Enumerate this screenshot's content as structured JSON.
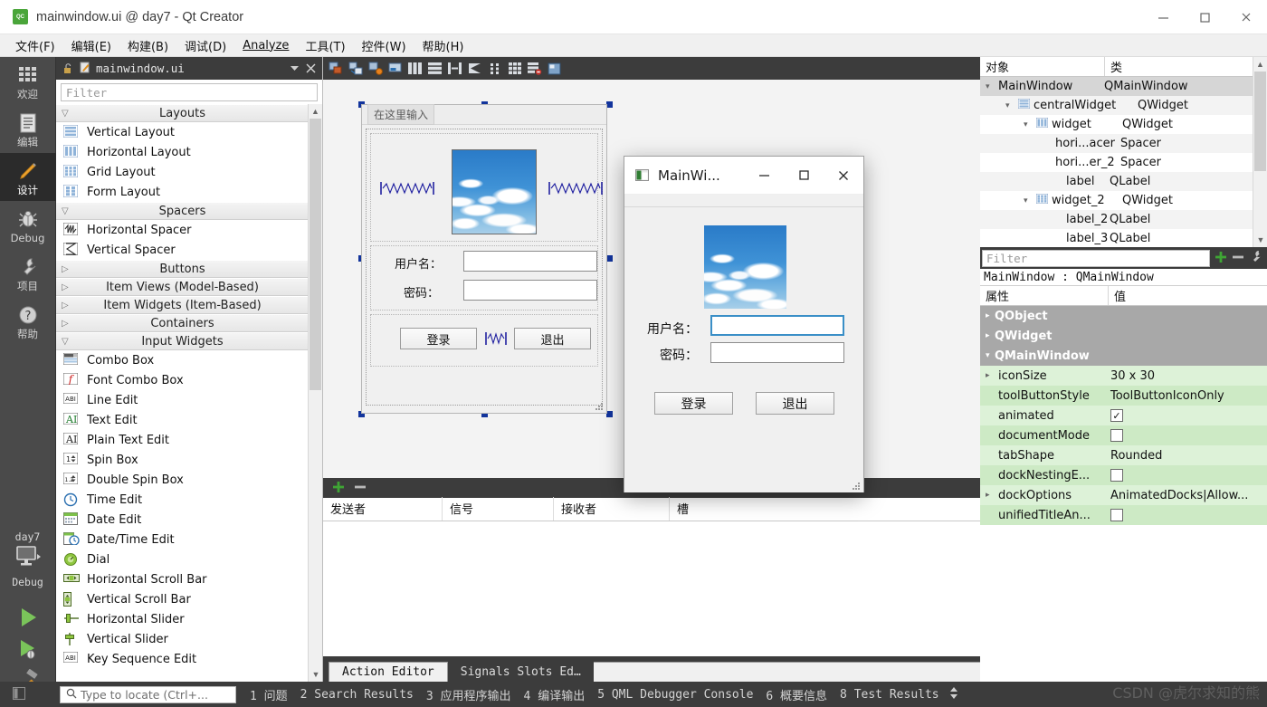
{
  "window": {
    "title": "mainwindow.ui @ day7 - Qt Creator",
    "app_icon": "qt-creator-icon",
    "minimize": "–",
    "maximize": "□",
    "close": "✕"
  },
  "menubar": {
    "items": [
      {
        "label": "文件(F)",
        "mnemonic": "F"
      },
      {
        "label": "编辑(E)",
        "mnemonic": "E"
      },
      {
        "label": "构建(B)",
        "mnemonic": "B"
      },
      {
        "label": "调试(D)",
        "mnemonic": "D"
      },
      {
        "label": "Analyze",
        "mnemonic": "A"
      },
      {
        "label": "工具(T)",
        "mnemonic": "T"
      },
      {
        "label": "控件(W)",
        "mnemonic": "W"
      },
      {
        "label": "帮助(H)",
        "mnemonic": "H"
      }
    ]
  },
  "modebar": {
    "modes": [
      {
        "label": "欢迎",
        "icon": "grid-icon",
        "active": false
      },
      {
        "label": "编辑",
        "icon": "document-icon",
        "active": false
      },
      {
        "label": "设计",
        "icon": "pencil-icon",
        "active": true
      },
      {
        "label": "Debug",
        "icon": "bug-icon",
        "active": false
      },
      {
        "label": "项目",
        "icon": "wrench-icon",
        "active": false
      },
      {
        "label": "帮助",
        "icon": "question-icon",
        "active": false
      }
    ],
    "kit": {
      "project": "day7",
      "config": "Debug",
      "icon": "desktop-icon"
    },
    "run_button": "run-icon",
    "debug_button": "run-debug-icon",
    "build_button": "hammer-icon"
  },
  "widgetbox": {
    "tab_label": "mainwindow.ui",
    "tab_icon": "file-edit-icon",
    "lock_icon": "unlocked-icon",
    "dropdown_icon": "chevron-down-icon",
    "close_icon": "close-icon",
    "filter_placeholder": "Filter",
    "groups": [
      {
        "name": "Layouts",
        "expanded": true,
        "items": [
          {
            "label": "Vertical Layout",
            "icon": "vertical-layout-icon"
          },
          {
            "label": "Horizontal Layout",
            "icon": "horizontal-layout-icon"
          },
          {
            "label": "Grid Layout",
            "icon": "grid-layout-icon"
          },
          {
            "label": "Form Layout",
            "icon": "form-layout-icon"
          }
        ]
      },
      {
        "name": "Spacers",
        "expanded": true,
        "items": [
          {
            "label": "Horizontal Spacer",
            "icon": "horizontal-spacer-icon"
          },
          {
            "label": "Vertical Spacer",
            "icon": "vertical-spacer-icon"
          }
        ]
      },
      {
        "name": "Buttons",
        "expanded": false,
        "items": []
      },
      {
        "name": "Item Views (Model-Based)",
        "expanded": false,
        "items": []
      },
      {
        "name": "Item Widgets (Item-Based)",
        "expanded": false,
        "items": []
      },
      {
        "name": "Containers",
        "expanded": false,
        "items": []
      },
      {
        "name": "Input Widgets",
        "expanded": true,
        "items": [
          {
            "label": "Combo Box",
            "icon": "combobox-icon"
          },
          {
            "label": "Font Combo Box",
            "icon": "fontcombo-icon"
          },
          {
            "label": "Line Edit",
            "icon": "lineedit-icon"
          },
          {
            "label": "Text Edit",
            "icon": "textedit-icon"
          },
          {
            "label": "Plain Text Edit",
            "icon": "plaintextedit-icon"
          },
          {
            "label": "Spin Box",
            "icon": "spinbox-icon"
          },
          {
            "label": "Double Spin Box",
            "icon": "doublespinbox-icon"
          },
          {
            "label": "Time Edit",
            "icon": "timeedit-icon"
          },
          {
            "label": "Date Edit",
            "icon": "dateedit-icon"
          },
          {
            "label": "Date/Time Edit",
            "icon": "datetimeedit-icon"
          },
          {
            "label": "Dial",
            "icon": "dial-icon"
          },
          {
            "label": "Horizontal Scroll Bar",
            "icon": "hscrollbar-icon"
          },
          {
            "label": "Vertical Scroll Bar",
            "icon": "vscrollbar-icon"
          },
          {
            "label": "Horizontal Slider",
            "icon": "hslider-icon"
          },
          {
            "label": "Vertical Slider",
            "icon": "vslider-icon"
          },
          {
            "label": "Key Sequence Edit",
            "icon": "keysequence-icon"
          }
        ]
      }
    ]
  },
  "designer": {
    "toolbar_icons": [
      "edit-widgets-icon",
      "edit-signals-slots-icon",
      "edit-buddies-icon",
      "edit-tab-order-icon",
      "layout-horizontal-icon",
      "layout-vertical-icon",
      "layout-splitter-h-icon",
      "layout-splitter-v-icon",
      "layout-form-icon",
      "layout-grid-icon",
      "break-layout-icon",
      "adjust-size-icon"
    ],
    "form": {
      "menubar_hint": "在这里输入",
      "image_label": "sky-image",
      "fields": [
        {
          "label": "用户名：",
          "value": ""
        },
        {
          "label": "密码：",
          "value": ""
        }
      ],
      "buttons": [
        {
          "label": "登录"
        },
        {
          "label": "退出"
        }
      ],
      "spacers": [
        "horizontal-spacer",
        "horizontal-spacer-2",
        "button-spacer"
      ]
    }
  },
  "preview": {
    "title": "MainWi...",
    "icon": "app-window-icon",
    "minimize": "–",
    "maximize": "□",
    "close": "✕",
    "image_label": "sky-image",
    "fields": [
      {
        "label": "用户名：",
        "value": "",
        "focused": true
      },
      {
        "label": "密码：",
        "value": "",
        "focused": false
      }
    ],
    "buttons": [
      {
        "label": "登录"
      },
      {
        "label": "退出"
      }
    ]
  },
  "signal_slot_editor": {
    "add_icon": "plus-icon",
    "remove_icon": "minus-icon",
    "columns": [
      "发送者",
      "信号",
      "接收者",
      "槽"
    ],
    "rows": [],
    "tabs": [
      {
        "label": "Action Editor",
        "active": true
      },
      {
        "label": "Signals  Slots Ed…",
        "active": false
      }
    ]
  },
  "object_inspector": {
    "columns": [
      "对象",
      "类"
    ],
    "rows": [
      {
        "name": "MainWindow",
        "class": "QMainWindow",
        "indent": 0,
        "twisty": "v",
        "icon": "",
        "selected": true
      },
      {
        "name": "centralWidget",
        "class": "QWidget",
        "indent": 1,
        "twisty": "v",
        "icon": "vertical-layout-icon",
        "selected": false
      },
      {
        "name": "widget",
        "class": "QWidget",
        "indent": 2,
        "twisty": "v",
        "icon": "horizontal-layout-icon",
        "selected": false
      },
      {
        "name": "hori...acer",
        "class": "Spacer",
        "indent": 3,
        "twisty": "",
        "icon": "",
        "selected": false
      },
      {
        "name": "hori...er_2",
        "class": "Spacer",
        "indent": 3,
        "twisty": "",
        "icon": "",
        "selected": false
      },
      {
        "name": "label",
        "class": "QLabel",
        "indent": 3,
        "twisty": "",
        "icon": "",
        "selected": false
      },
      {
        "name": "widget_2",
        "class": "QWidget",
        "indent": 2,
        "twisty": "v",
        "icon": "grid-layout-icon",
        "selected": false
      },
      {
        "name": "label_2",
        "class": "QLabel",
        "indent": 3,
        "twisty": "",
        "icon": "",
        "selected": false
      },
      {
        "name": "label_3",
        "class": "QLabel",
        "indent": 3,
        "twisty": "",
        "icon": "",
        "selected": false
      }
    ]
  },
  "property_editor": {
    "filter_placeholder": "Filter",
    "add_icon": "plus-icon",
    "remove_icon": "minus-icon",
    "configure_icon": "wrench-icon",
    "object_line": "MainWindow : QMainWindow",
    "columns": [
      "属性",
      "值"
    ],
    "groups": [
      {
        "name": "QObject",
        "expanded": false
      },
      {
        "name": "QWidget",
        "expanded": false
      },
      {
        "name": "QMainWindow",
        "expanded": true
      }
    ],
    "rows": [
      {
        "key": "iconSize",
        "value": "30 x 30",
        "type": "text",
        "twisty": true
      },
      {
        "key": "toolButtonStyle",
        "value": "ToolButtonIconOnly",
        "type": "text",
        "twisty": false
      },
      {
        "key": "animated",
        "value": "",
        "type": "checkbox",
        "checked": true,
        "twisty": false
      },
      {
        "key": "documentMode",
        "value": "",
        "type": "checkbox",
        "checked": false,
        "twisty": false
      },
      {
        "key": "tabShape",
        "value": "Rounded",
        "type": "text",
        "twisty": false
      },
      {
        "key": "dockNestingE...",
        "value": "",
        "type": "checkbox",
        "checked": false,
        "twisty": false
      },
      {
        "key": "dockOptions",
        "value": "AnimatedDocks|Allow...",
        "type": "text",
        "twisty": true
      },
      {
        "key": "unifiedTitleAn...",
        "value": "",
        "type": "checkbox",
        "checked": false,
        "twisty": false
      }
    ]
  },
  "statusbar": {
    "sidebar_toggle_icon": "sidebar-icon",
    "locator_placeholder": "Type to locate (Ctrl+...",
    "locator_icon": "search-icon",
    "panes": [
      "1 问题",
      "2 Search Results",
      "3 应用程序输出",
      "4 编译输出",
      "5 QML Debugger Console",
      "6 概要信息",
      "8 Test Results"
    ],
    "updown_icon": "up-down-icon",
    "watermark": "CSDN @虎尔求知的熊"
  },
  "colors": {
    "accent_blue": "#12349c",
    "mode_active_bg": "#2b2b2b",
    "dark_chrome": "#3c3c3c",
    "prop_green": "#ddf2d8",
    "prop_green_alt": "#cdeac5",
    "sky_blue": "#3f92d6",
    "green_plus": "#3fa535"
  }
}
